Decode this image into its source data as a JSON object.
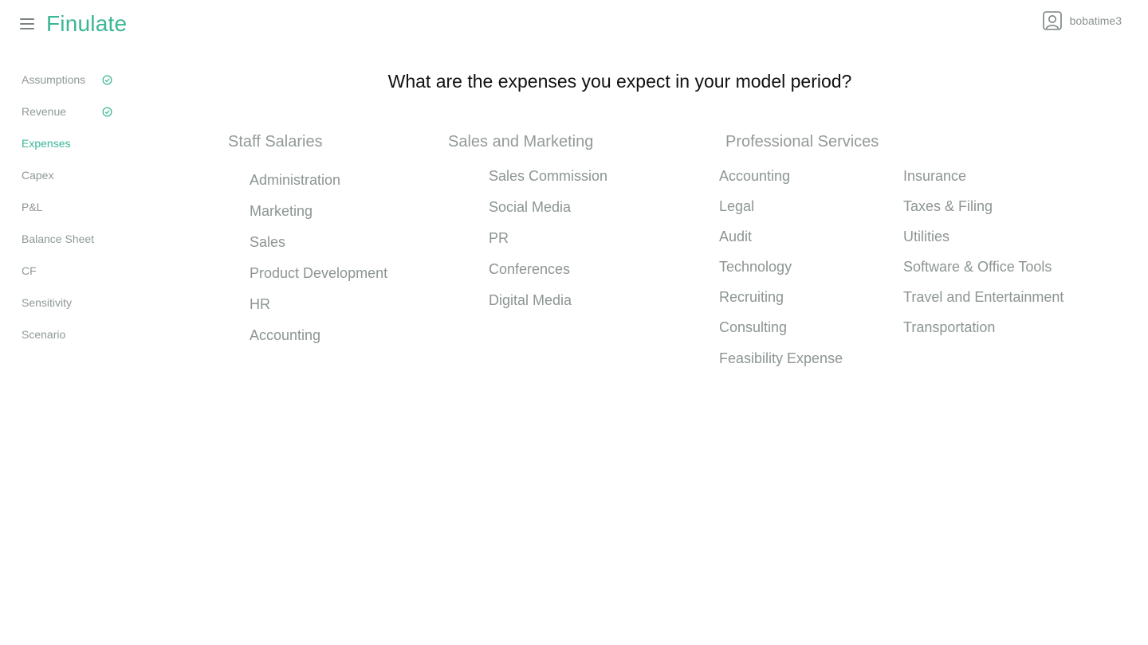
{
  "app": {
    "logo": "Finulate"
  },
  "user": {
    "name": "bobatime3"
  },
  "sidebar": {
    "items": [
      {
        "label": "Assumptions",
        "done": true
      },
      {
        "label": "Revenue",
        "done": true
      },
      {
        "label": "Expenses",
        "active": true
      },
      {
        "label": "Capex"
      },
      {
        "label": "P&L"
      },
      {
        "label": "Balance Sheet"
      },
      {
        "label": "CF"
      },
      {
        "label": "Sensitivity"
      },
      {
        "label": "Scenario"
      }
    ]
  },
  "main": {
    "question": "What are the expenses you expect in your model period?",
    "staff": {
      "title": "Staff Salaries",
      "items": [
        "Administration",
        "Marketing",
        "Sales",
        "Product Development",
        "HR",
        "Accounting"
      ]
    },
    "sales_marketing": {
      "title": "Sales and Marketing",
      "items": [
        "Sales Commission",
        "Social Media",
        "PR",
        "Conferences",
        "Digital Media"
      ]
    },
    "professional": {
      "title": "Professional Services",
      "left_items": [
        "Accounting",
        "Legal",
        "Audit",
        "Technology",
        "Recruiting",
        "Consulting",
        "Feasibility Expense"
      ],
      "right_items": [
        "Insurance",
        "Taxes & Filing",
        "Utilities",
        "Software & Office Tools",
        "Travel and Entertainment",
        "Transportation"
      ]
    }
  },
  "colors": {
    "accent": "#3ab795",
    "muted": "#8c9592",
    "text": "#111111"
  }
}
